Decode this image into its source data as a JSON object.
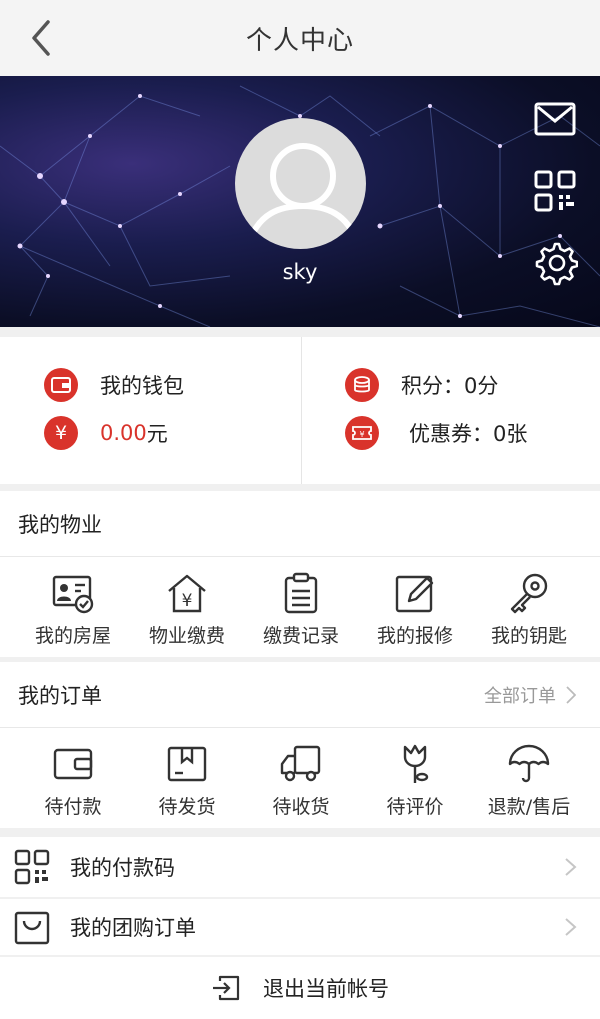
{
  "header": {
    "title": "个人中心"
  },
  "profile": {
    "username": "sky"
  },
  "wallet": {
    "label": "我的钱包",
    "amount": "0.00",
    "unit": "元",
    "points": "积分：0分",
    "coupons": "优惠券：0张"
  },
  "property": {
    "title": "我的物业",
    "items": [
      {
        "label": "我的房屋",
        "icon": "id-card-check-icon"
      },
      {
        "label": "物业缴费",
        "icon": "house-yen-icon"
      },
      {
        "label": "缴费记录",
        "icon": "clipboard-list-icon"
      },
      {
        "label": "我的报修",
        "icon": "edit-pencil-icon"
      },
      {
        "label": "我的钥匙",
        "icon": "key-icon"
      }
    ]
  },
  "orders": {
    "title": "我的订单",
    "all_label": "全部订单",
    "items": [
      {
        "label": "待付款",
        "icon": "wallet-icon"
      },
      {
        "label": "待发货",
        "icon": "package-icon"
      },
      {
        "label": "待收货",
        "icon": "truck-icon"
      },
      {
        "label": "待评价",
        "icon": "flower-icon"
      },
      {
        "label": "退款/售后",
        "icon": "umbrella-icon"
      }
    ]
  },
  "menu": {
    "pay_code": "我的付款码",
    "group_orders": "我的团购订单"
  },
  "logout": {
    "label": "退出当前帐号"
  },
  "colors": {
    "accent": "#d9332b",
    "background": "#f0f0f0"
  }
}
